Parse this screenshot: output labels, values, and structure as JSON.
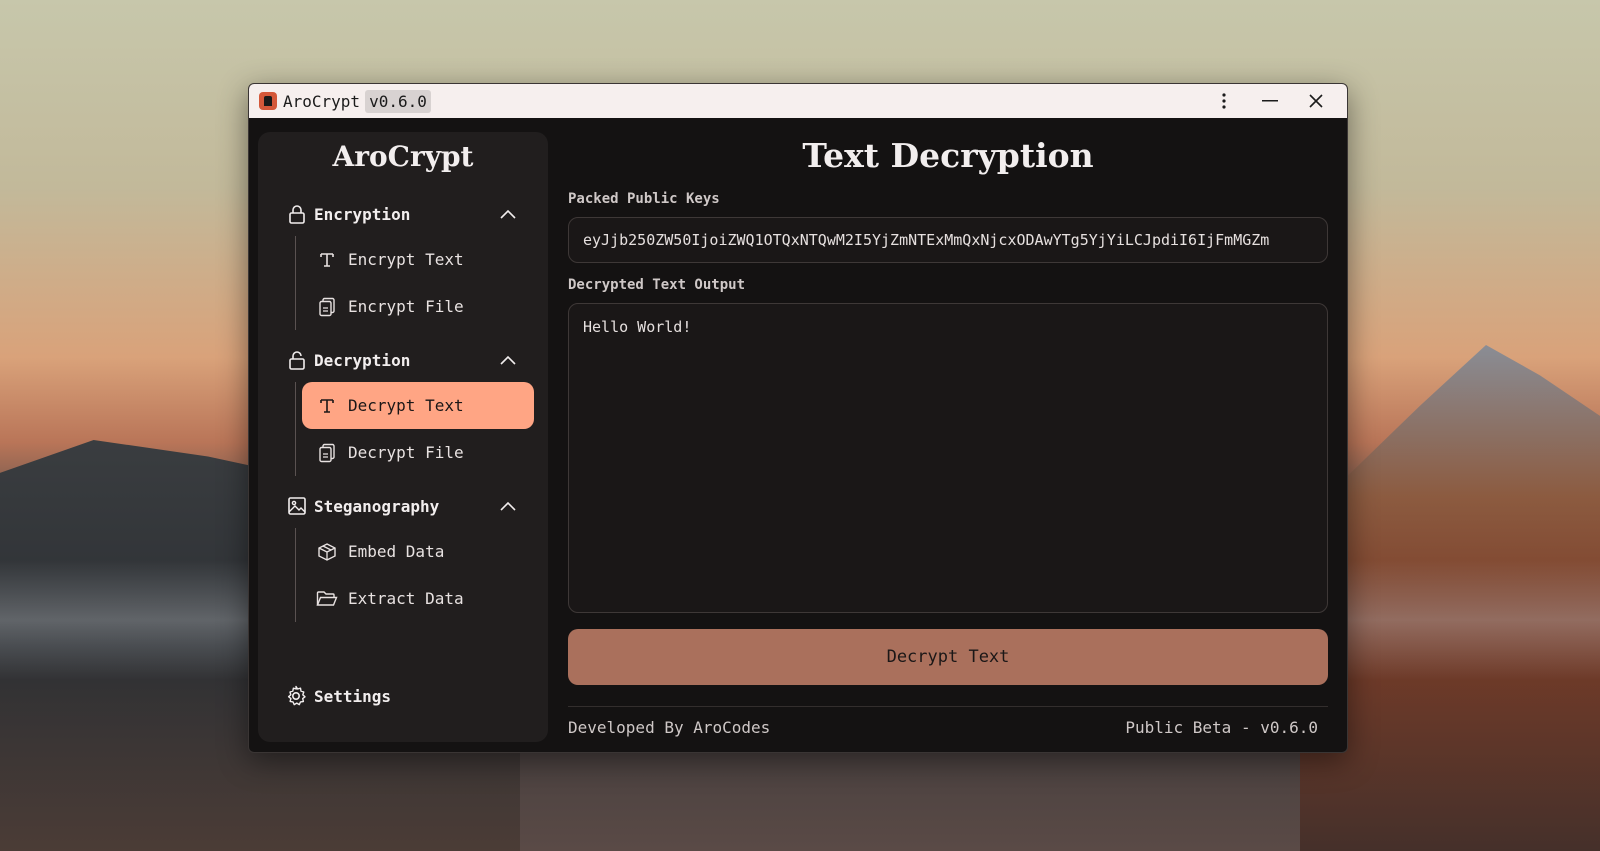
{
  "window": {
    "title": "AroCrypt",
    "version_badge": "v0.6.0"
  },
  "sidebar": {
    "brand": "AroCrypt",
    "sections": [
      {
        "label": "Encryption",
        "icon": "lock-icon",
        "items": [
          {
            "label": "Encrypt Text",
            "icon": "text-icon"
          },
          {
            "label": "Encrypt File",
            "icon": "files-icon"
          }
        ]
      },
      {
        "label": "Decryption",
        "icon": "unlock-icon",
        "items": [
          {
            "label": "Decrypt Text",
            "icon": "text-icon",
            "active": true
          },
          {
            "label": "Decrypt File",
            "icon": "files-icon"
          }
        ]
      },
      {
        "label": "Steganography",
        "icon": "image-icon",
        "items": [
          {
            "label": "Embed Data",
            "icon": "box-icon"
          },
          {
            "label": "Extract Data",
            "icon": "folder-open-icon"
          }
        ]
      }
    ],
    "settings_label": "Settings"
  },
  "main": {
    "title": "Text Decryption",
    "keys_label": "Packed Public Keys",
    "keys_value": "eyJjb250ZW50IjoiZWQ1OTQxNTQwM2I5YjZmNTExMmQxNjcxODAwYTg5YjYiLCJpdiI6IjFmMGZm",
    "output_label": "Decrypted Text Output",
    "output_value": "Hello World!",
    "button_label": "Decrypt Text"
  },
  "footer": {
    "left": "Developed By AroCodes",
    "right": "Public Beta - v0.6.0"
  },
  "colors": {
    "accent": "#ffa584",
    "button": "#aa705c",
    "background": "#141212",
    "sidebar": "#211e1e"
  }
}
